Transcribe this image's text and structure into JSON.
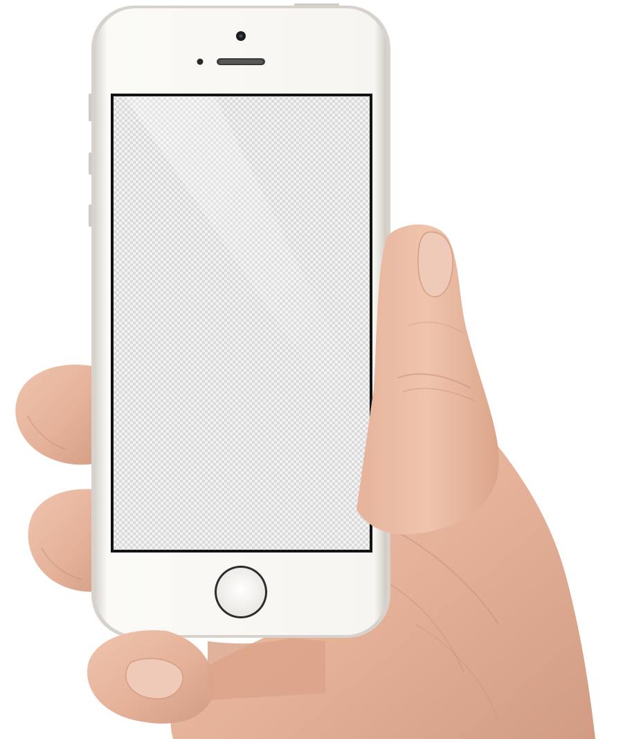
{
  "scene": {
    "description_visible_text": "",
    "background_color": "#ffffff"
  },
  "phone": {
    "model_color": "silver-white",
    "body_color": "#f6f4f0",
    "bezel_color": "#fbfaf7",
    "screen_border_color": "#141414",
    "screen_state": "blank-transparent",
    "screen_checker_light": "#f2f2f2",
    "screen_checker_dark": "#d8d8d8",
    "home_button_ring_color": "#2a2a2a"
  },
  "hand": {
    "skin_color": "#e7b79f",
    "skin_shadow": "#c98e74",
    "nail_color": "#efcab9"
  },
  "icons": {
    "camera": "front-camera-icon",
    "speaker": "earpiece-speaker-icon",
    "sensor": "proximity-sensor-icon",
    "home": "home-button-icon"
  }
}
